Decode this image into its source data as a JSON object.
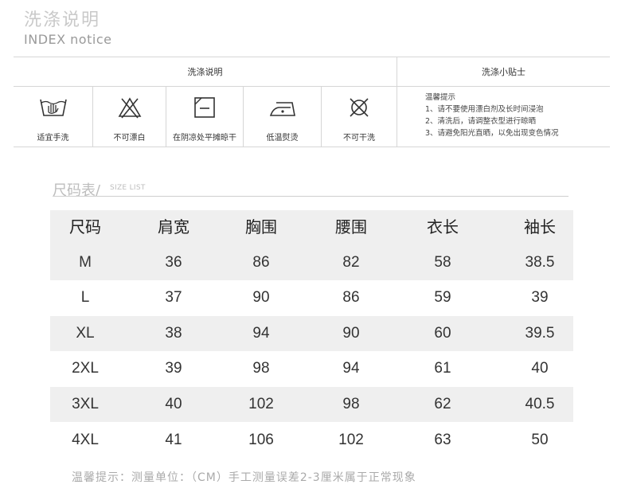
{
  "header": {
    "title_cn": "洗涤说明",
    "title_en": "INDEX notice"
  },
  "care": {
    "left_header": "洗涤说明",
    "right_header": "洗涤小贴士",
    "items": [
      {
        "icon": "hand-wash-icon",
        "label": "适宜手洗"
      },
      {
        "icon": "no-bleach-icon",
        "label": "不可漂白"
      },
      {
        "icon": "shade-dry-flat-icon",
        "label": "在阴凉处平摊晾干"
      },
      {
        "icon": "low-iron-icon",
        "label": "低温熨烫"
      },
      {
        "icon": "no-dry-clean-icon",
        "label": "不可干洗"
      }
    ],
    "tips": {
      "title": "温馨提示",
      "lines": [
        "1、请不要使用漂白剂及长时间浸泡",
        "2、清洗后，请调整衣型进行晾晒",
        "3、请避免阳光直晒，以免出现变色情况"
      ]
    }
  },
  "size_table": {
    "title": "尺码表/",
    "subtitle": "SIZE LIST",
    "columns": [
      "尺码",
      "肩宽",
      "胸围",
      "腰围",
      "衣长",
      "袖长"
    ],
    "rows": [
      [
        "M",
        "36",
        "86",
        "82",
        "58",
        "38.5"
      ],
      [
        "L",
        "37",
        "90",
        "86",
        "59",
        "39"
      ],
      [
        "XL",
        "38",
        "94",
        "90",
        "60",
        "39.5"
      ],
      [
        "2XL",
        "39",
        "98",
        "94",
        "61",
        "40"
      ],
      [
        "3XL",
        "40",
        "102",
        "98",
        "62",
        "40.5"
      ],
      [
        "4XL",
        "41",
        "106",
        "102",
        "63",
        "50"
      ]
    ],
    "note": "温馨提示：测量单位：（CM）手工测量误差2-3厘米属于正常现象"
  }
}
